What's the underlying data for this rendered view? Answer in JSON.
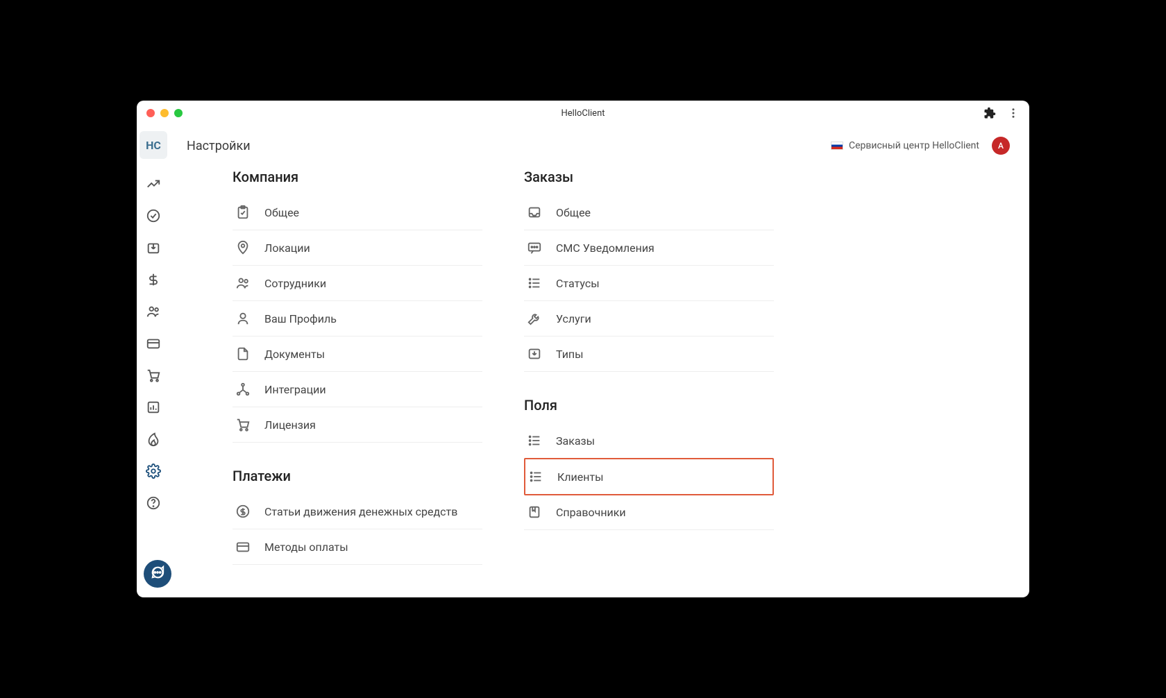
{
  "window": {
    "title": "HelloClient",
    "logo": "HC"
  },
  "topbar": {
    "page_title": "Настройки",
    "company_name": "Сервисный центр HelloClient",
    "avatar_initial": "A"
  },
  "sections": {
    "company": {
      "title": "Компания",
      "items": [
        {
          "label": "Общее"
        },
        {
          "label": "Локации"
        },
        {
          "label": "Сотрудники"
        },
        {
          "label": "Ваш Профиль"
        },
        {
          "label": "Документы"
        },
        {
          "label": "Интеграции"
        },
        {
          "label": "Лицензия"
        }
      ]
    },
    "orders": {
      "title": "Заказы",
      "items": [
        {
          "label": "Общее"
        },
        {
          "label": "СМС Уведомления"
        },
        {
          "label": "Статусы"
        },
        {
          "label": "Услуги"
        },
        {
          "label": "Типы"
        }
      ]
    },
    "payments": {
      "title": "Платежи",
      "items": [
        {
          "label": "Статьи движения денежных средств"
        },
        {
          "label": "Методы оплаты"
        }
      ]
    },
    "fields": {
      "title": "Поля",
      "items": [
        {
          "label": "Заказы"
        },
        {
          "label": "Клиенты"
        },
        {
          "label": "Справочники"
        }
      ]
    }
  }
}
